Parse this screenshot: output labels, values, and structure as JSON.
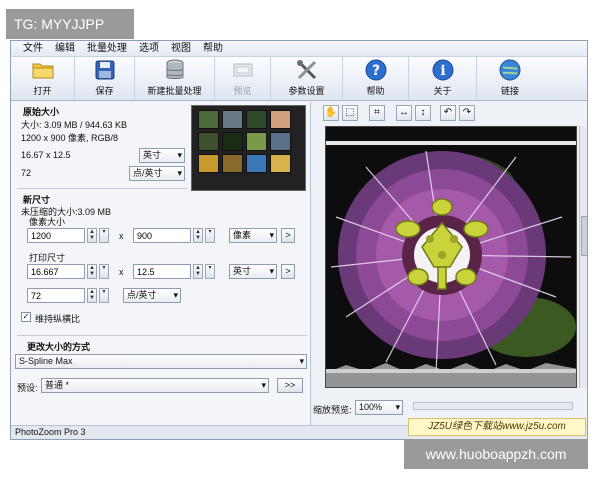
{
  "watermarks": {
    "top": "TG: MYYJJPP",
    "bottom": "www.huoboappzh.com",
    "site": "JZ5U绿色下载站www.jz5u.com"
  },
  "menu": [
    "文件",
    "编辑",
    "批量处理",
    "选项",
    "视图",
    "帮助"
  ],
  "toolbar": [
    {
      "label": "打开",
      "icon": "folder-icon",
      "enabled": true
    },
    {
      "label": "保存",
      "icon": "save-icon",
      "enabled": true
    },
    {
      "label": "新建批量处理",
      "icon": "database-icon",
      "enabled": true
    },
    {
      "label": "预览",
      "icon": "preview-icon",
      "enabled": false
    },
    {
      "label": "参数设置",
      "icon": "tools-icon",
      "enabled": true
    },
    {
      "label": "帮助",
      "icon": "help-icon",
      "enabled": true
    },
    {
      "label": "关于",
      "icon": "info-icon",
      "enabled": true
    },
    {
      "label": "链接",
      "icon": "globe-icon",
      "enabled": true
    }
  ],
  "original": {
    "section": "原始大小",
    "size_line": "大小: 3.09 MB / 944.63 KB",
    "pixels_line": "1200 x 900 像素, RGB/8",
    "dimensions": "16.67 x 12.5",
    "dimensions_unit": "英寸",
    "resolution": "72",
    "resolution_unit": "点/英寸"
  },
  "new_size": {
    "section": "新尺寸",
    "uncompressed": "未压缩的大小:3.09 MB",
    "pixel_section": "像素大小",
    "width_px": "1200",
    "height_px": "900",
    "pixel_unit": "像素",
    "print_section": "打印尺寸",
    "width_print": "16.667",
    "height_print": "12.5",
    "print_unit": "英寸",
    "resolution": "72",
    "resolution_unit": "点/英寸",
    "keep_ratio": "维持纵横比",
    "times": "x",
    "more": ">"
  },
  "resize_method": {
    "section": "更改大小的方式",
    "method": "S-Spline Max",
    "preset_label": "预设:",
    "preset": "普通 *",
    "more": ">>"
  },
  "preview": {
    "zoom_label": "缩放预览:",
    "zoom": "100%"
  },
  "status": "PhotoZoom Pro 3"
}
